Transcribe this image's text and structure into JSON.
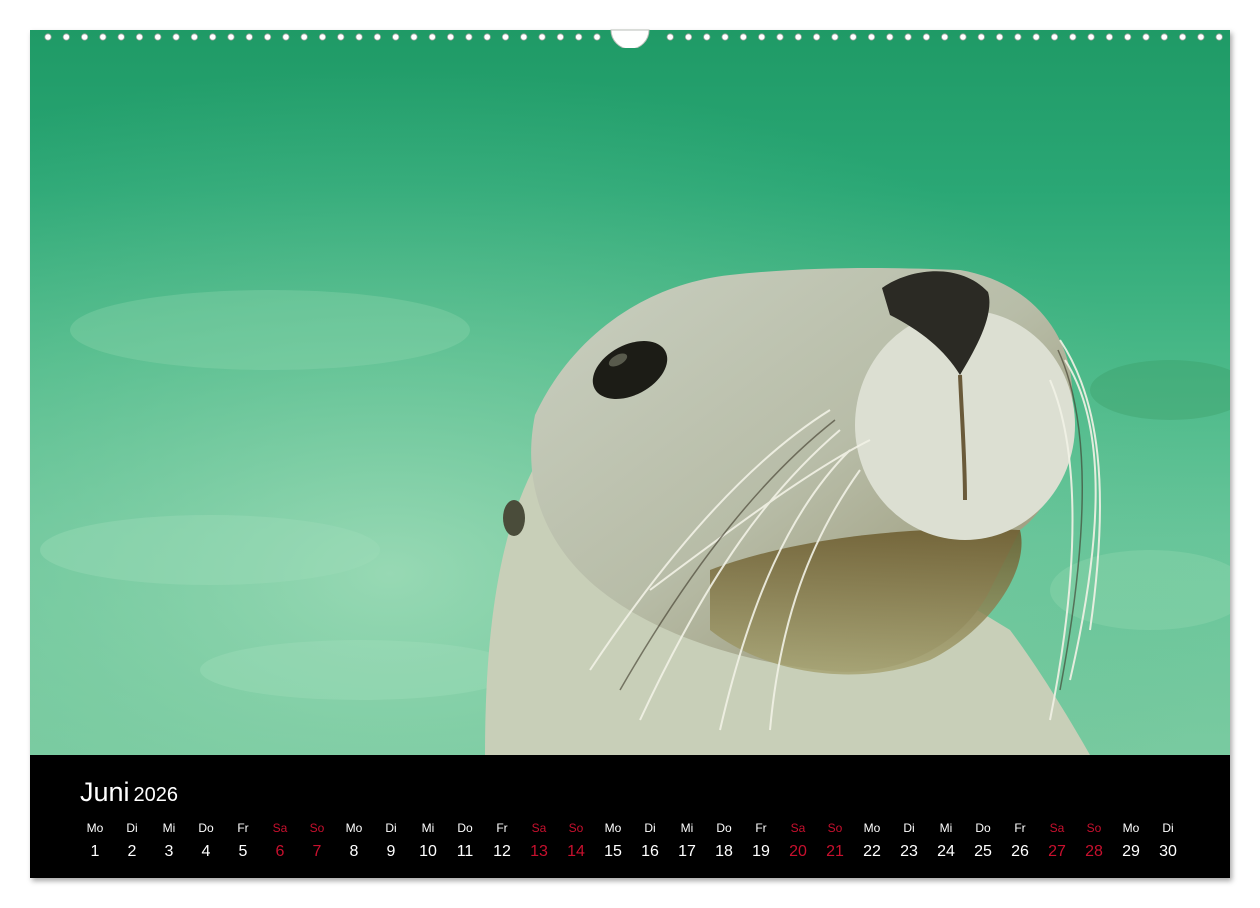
{
  "calendar": {
    "month": "Juni",
    "year": "2026",
    "days": [
      {
        "wd": "Mo",
        "d": "1",
        "weekend": false
      },
      {
        "wd": "Di",
        "d": "2",
        "weekend": false
      },
      {
        "wd": "Mi",
        "d": "3",
        "weekend": false
      },
      {
        "wd": "Do",
        "d": "4",
        "weekend": false
      },
      {
        "wd": "Fr",
        "d": "5",
        "weekend": false
      },
      {
        "wd": "Sa",
        "d": "6",
        "weekend": true
      },
      {
        "wd": "So",
        "d": "7",
        "weekend": true
      },
      {
        "wd": "Mo",
        "d": "8",
        "weekend": false
      },
      {
        "wd": "Di",
        "d": "9",
        "weekend": false
      },
      {
        "wd": "Mi",
        "d": "10",
        "weekend": false
      },
      {
        "wd": "Do",
        "d": "11",
        "weekend": false
      },
      {
        "wd": "Fr",
        "d": "12",
        "weekend": false
      },
      {
        "wd": "Sa",
        "d": "13",
        "weekend": true
      },
      {
        "wd": "So",
        "d": "14",
        "weekend": true
      },
      {
        "wd": "Mo",
        "d": "15",
        "weekend": false
      },
      {
        "wd": "Di",
        "d": "16",
        "weekend": false
      },
      {
        "wd": "Mi",
        "d": "17",
        "weekend": false
      },
      {
        "wd": "Do",
        "d": "18",
        "weekend": false
      },
      {
        "wd": "Fr",
        "d": "19",
        "weekend": false
      },
      {
        "wd": "Sa",
        "d": "20",
        "weekend": true
      },
      {
        "wd": "So",
        "d": "21",
        "weekend": true
      },
      {
        "wd": "Mo",
        "d": "22",
        "weekend": false
      },
      {
        "wd": "Di",
        "d": "23",
        "weekend": false
      },
      {
        "wd": "Mi",
        "d": "24",
        "weekend": false
      },
      {
        "wd": "Do",
        "d": "25",
        "weekend": false
      },
      {
        "wd": "Fr",
        "d": "26",
        "weekend": false
      },
      {
        "wd": "Sa",
        "d": "27",
        "weekend": true
      },
      {
        "wd": "So",
        "d": "28",
        "weekend": true
      },
      {
        "wd": "Mo",
        "d": "29",
        "weekend": false
      },
      {
        "wd": "Di",
        "d": "30",
        "weekend": false
      }
    ]
  },
  "colors": {
    "weekday_text": "#ffffff",
    "weekend_text": "#c8102e",
    "strip_background": "#000000",
    "water": "#2aa775"
  }
}
